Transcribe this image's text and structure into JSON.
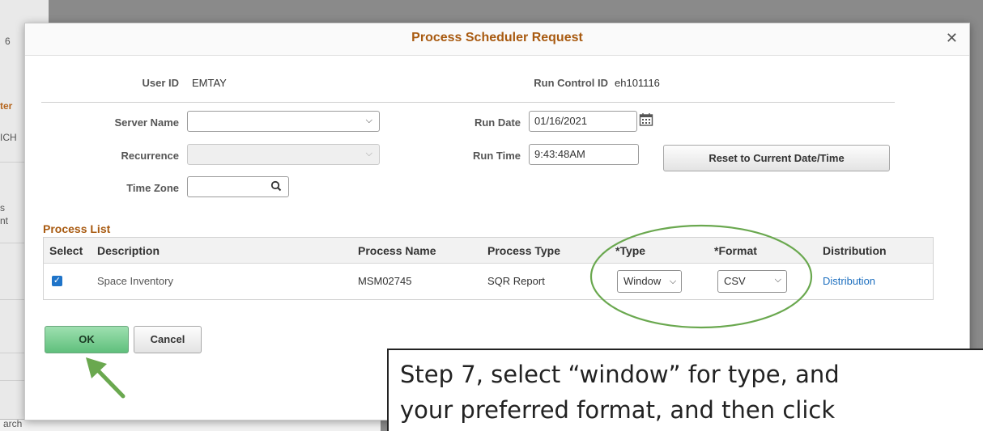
{
  "background": {
    "fragments": [
      "6",
      "ter",
      "ICH",
      "s",
      "nt",
      "arch"
    ]
  },
  "dialog": {
    "title": "Process Scheduler Request",
    "close_icon": "close-icon",
    "user_id_label": "User ID",
    "user_id_value": "EMTAY",
    "run_control_label": "Run Control ID",
    "run_control_value": "eh101116",
    "server_name_label": "Server Name",
    "server_name_value": "",
    "recurrence_label": "Recurrence",
    "recurrence_value": "",
    "time_zone_label": "Time Zone",
    "time_zone_value": "",
    "run_date_label": "Run Date",
    "run_date_value": "01/16/2021",
    "run_time_label": "Run Time",
    "run_time_value": "9:43:48AM",
    "reset_button": "Reset to Current Date/Time"
  },
  "process_list": {
    "title": "Process List",
    "columns": [
      "Select",
      "Description",
      "Process Name",
      "Process Type",
      "*Type",
      "*Format",
      "Distribution"
    ],
    "rows": [
      {
        "selected": true,
        "description": "Space Inventory",
        "process_name": "MSM02745",
        "process_type": "SQR Report",
        "type": "Window",
        "format": "CSV",
        "distribution": "Distribution"
      }
    ]
  },
  "buttons": {
    "ok": "OK",
    "cancel": "Cancel"
  },
  "annotation": {
    "line1": "Step 7, select “window” for type, and",
    "line2": "your preferred format, and then click",
    "highlight_color": "#6aa84f",
    "arrow_color": "#6aa84f"
  },
  "colors": {
    "title": "#a85a10",
    "link": "#1d6fbf",
    "ok_button": "#5fbf7c",
    "checkbox": "#1f74c9"
  }
}
